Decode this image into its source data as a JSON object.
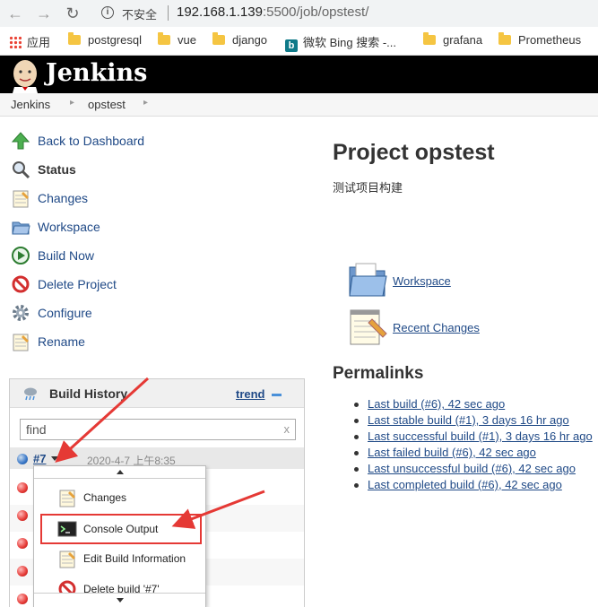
{
  "browser": {
    "security_label": "不安全",
    "url_host": "192.168.1.139",
    "url_rest": ":5500/job/opstest/",
    "bookmarks": [
      "应用",
      "postgresql",
      "vue",
      "django",
      "微软 Bing 搜索 -...",
      "grafana",
      "Prometheus"
    ]
  },
  "jenkins": {
    "brand": "Jenkins",
    "breadcrumb": [
      "Jenkins",
      "opstest"
    ]
  },
  "sidebar": {
    "tasks": [
      "Back to Dashboard",
      "Status",
      "Changes",
      "Workspace",
      "Build Now",
      "Delete Project",
      "Configure",
      "Rename"
    ]
  },
  "build_history": {
    "title": "Build History",
    "trend_label": "trend",
    "find_value": "find",
    "clear_label": "x",
    "selected_build": "#7",
    "selected_time": "2020-4-7 上午8:35"
  },
  "context_menu": {
    "items": [
      "Changes",
      "Console Output",
      "Edit Build Information",
      "Delete build '#7'"
    ]
  },
  "main": {
    "title": "Project opstest",
    "description": "测试项目构建",
    "workspace_link": "Workspace",
    "recent_changes_link": "Recent Changes",
    "permalinks_title": "Permalinks",
    "permalinks": [
      "Last build (#6), 42 sec ago",
      "Last stable build (#1), 3 days 16 hr ago",
      "Last successful build (#1), 3 days 16 hr ago",
      "Last failed build (#6), 42 sec ago",
      "Last unsuccessful build (#6), 42 sec ago",
      "Last completed build (#6), 42 sec ago"
    ]
  },
  "colors": {
    "link": "#204a87",
    "annotation_red": "#e53935",
    "header_bg": "#000000"
  }
}
